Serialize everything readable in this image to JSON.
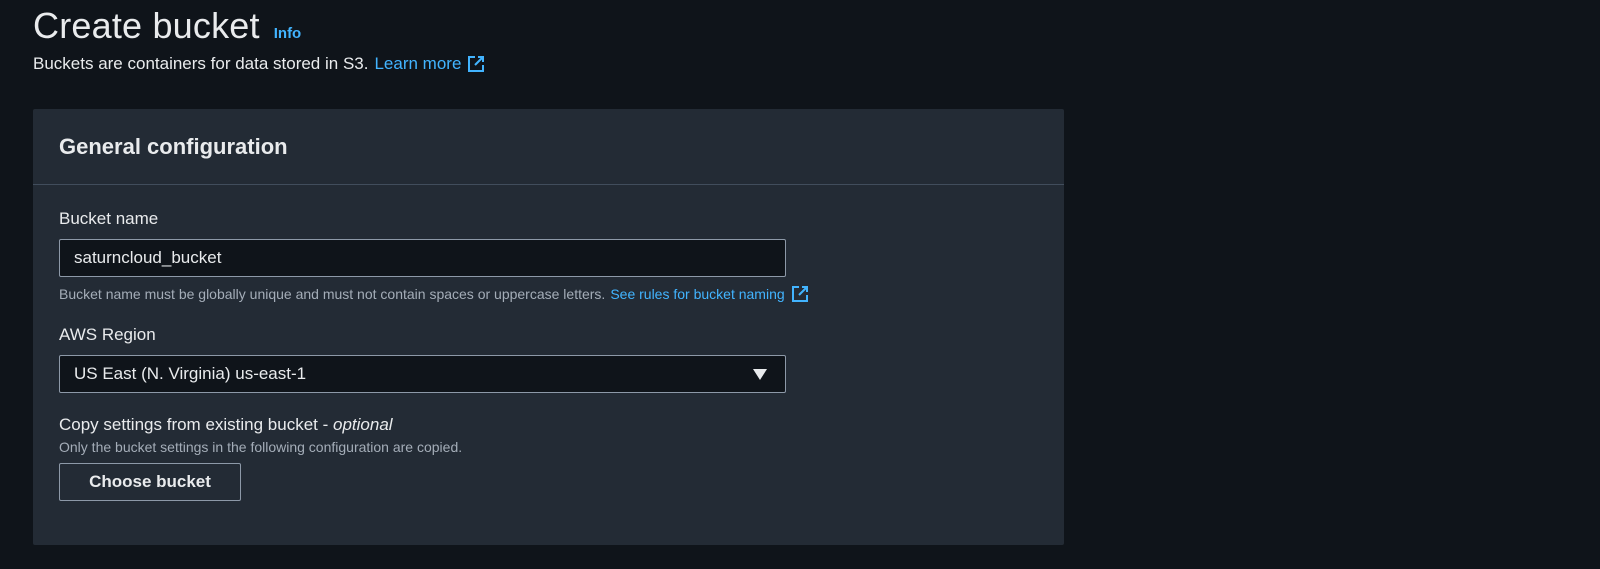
{
  "header": {
    "title": "Create bucket",
    "info_label": "Info",
    "subtitle_text": "Buckets are containers for data stored in S3.",
    "learn_more_label": "Learn more"
  },
  "general_configuration": {
    "title": "General configuration",
    "bucket_name": {
      "label": "Bucket name",
      "value": "saturncloud_bucket",
      "hint": "Bucket name must be globally unique and must not contain spaces or uppercase letters.",
      "rules_link_label": "See rules for bucket naming"
    },
    "aws_region": {
      "label": "AWS Region",
      "selected": "US East (N. Virginia) us-east-1"
    },
    "copy_settings": {
      "label": "Copy settings from existing bucket - ",
      "label_optional": "optional",
      "description": "Only the bucket settings in the following configuration are copied.",
      "button_label": "Choose bucket"
    }
  },
  "colors": {
    "background": "#0f141a",
    "panel": "#232b35",
    "link": "#42b4ff",
    "text": "#e9ebed",
    "muted": "#a4adb8",
    "border": "#8d99a8"
  },
  "icons": {
    "external_link": "external-link-icon",
    "dropdown_caret": "caret-down-icon"
  }
}
